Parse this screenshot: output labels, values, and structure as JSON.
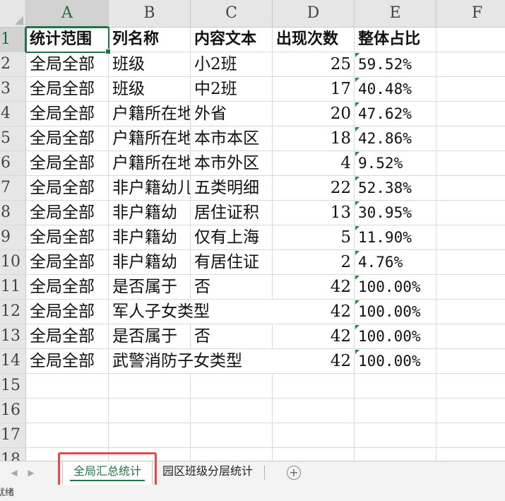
{
  "column_headers": [
    "A",
    "B",
    "C",
    "D",
    "E",
    "F"
  ],
  "row_numbers": [
    "1",
    "2",
    "3",
    "4",
    "5",
    "6",
    "7",
    "8",
    "9",
    "10",
    "11",
    "12",
    "13",
    "14",
    "15",
    "16",
    "17",
    "18"
  ],
  "header_row": [
    "统计范围",
    "列名称",
    "内容文本",
    "出现次数",
    "整体占比"
  ],
  "rows": [
    [
      "全局全部",
      "班级",
      "小2班",
      "25",
      "59.52%"
    ],
    [
      "全局全部",
      "班级",
      "中2班",
      "17",
      "40.48%"
    ],
    [
      "全局全部",
      "户籍所在地",
      "外省",
      "20",
      "47.62%"
    ],
    [
      "全局全部",
      "户籍所在地",
      "本市本区",
      "18",
      "42.86%"
    ],
    [
      "全局全部",
      "户籍所在地",
      "本市外区",
      "4",
      "9.52%"
    ],
    [
      "全局全部",
      "非户籍幼儿",
      "五类明细",
      "22",
      "52.38%"
    ],
    [
      "全局全部",
      "非户籍幼",
      "居住证积",
      "13",
      "30.95%"
    ],
    [
      "全局全部",
      "非户籍幼",
      "仅有上海",
      "5",
      "11.90%"
    ],
    [
      "全局全部",
      "非户籍幼",
      "有居住证",
      "2",
      "4.76%"
    ],
    [
      "全局全部",
      "是否属于",
      "否",
      "42",
      "100.00%"
    ],
    [
      "全局全部",
      "军人子女类型",
      "",
      "42",
      "100.00%"
    ],
    [
      "全局全部",
      "是否属于",
      "否",
      "42",
      "100.00%"
    ],
    [
      "全局全部",
      "武警消防子女类型",
      "",
      "42",
      "100.00%"
    ]
  ],
  "tabs": [
    {
      "label": "全局汇总统计",
      "active": true
    },
    {
      "label": "园区班级分层统计",
      "active": false
    }
  ],
  "status_text": "就绪",
  "colors": {
    "accent": "#217346",
    "highlight": "#e8474c"
  }
}
